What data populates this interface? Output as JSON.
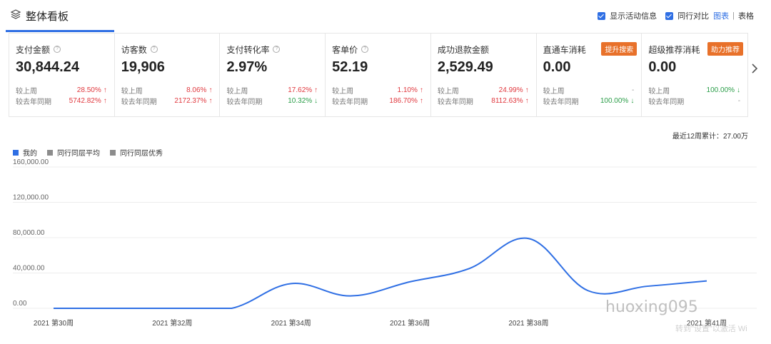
{
  "header": {
    "title": "整体看板",
    "show_activity_label": "显示活动信息",
    "peer_compare_label": "同行对比",
    "view_chart": "图表",
    "view_separator": "|",
    "view_table": "表格"
  },
  "metrics": [
    {
      "name": "支付金额",
      "value": "30,844.24",
      "tag": "",
      "help": true,
      "rows": [
        {
          "label": "较上周",
          "pct": "28.50%",
          "dir": "up"
        },
        {
          "label": "较去年同期",
          "pct": "5742.82%",
          "dir": "up"
        }
      ]
    },
    {
      "name": "访客数",
      "value": "19,906",
      "tag": "",
      "help": true,
      "rows": [
        {
          "label": "较上周",
          "pct": "8.06%",
          "dir": "up"
        },
        {
          "label": "较去年同期",
          "pct": "2172.37%",
          "dir": "up"
        }
      ]
    },
    {
      "name": "支付转化率",
      "value": "2.97%",
      "tag": "",
      "help": true,
      "rows": [
        {
          "label": "较上周",
          "pct": "17.62%",
          "dir": "up"
        },
        {
          "label": "较去年同期",
          "pct": "10.32%",
          "dir": "down"
        }
      ]
    },
    {
      "name": "客单价",
      "value": "52.19",
      "tag": "",
      "help": true,
      "rows": [
        {
          "label": "较上周",
          "pct": "1.10%",
          "dir": "up"
        },
        {
          "label": "较去年同期",
          "pct": "186.70%",
          "dir": "up"
        }
      ]
    },
    {
      "name": "成功退款金额",
      "value": "2,529.49",
      "tag": "",
      "help": false,
      "rows": [
        {
          "label": "较上周",
          "pct": "24.99%",
          "dir": "up"
        },
        {
          "label": "较去年同期",
          "pct": "8112.63%",
          "dir": "up"
        }
      ]
    },
    {
      "name": "直通车消耗",
      "value": "0.00",
      "tag": "提升搜索",
      "help": false,
      "rows": [
        {
          "label": "较上周",
          "pct": "-",
          "dir": "none"
        },
        {
          "label": "较去年同期",
          "pct": "100.00%",
          "dir": "down"
        }
      ]
    },
    {
      "name": "超级推荐消耗",
      "value": "0.00",
      "tag": "助力推荐",
      "help": false,
      "rows": [
        {
          "label": "较上周",
          "pct": "100.00%",
          "dir": "down"
        },
        {
          "label": "较去年同期",
          "pct": "-",
          "dir": "none"
        }
      ]
    }
  ],
  "colors": {
    "accent": "#2f6fe4",
    "up": "#e0383e",
    "down": "#2a9d48",
    "tag": "#e8712a"
  },
  "icons": {
    "title": "layers-icon",
    "next": "chevron-right-icon"
  },
  "cumulative": "最近12周累计：27.00万",
  "legend": [
    {
      "name": "我的",
      "color": "#2f6fe4"
    },
    {
      "name": "同行同层平均",
      "color": "#8c8c8c"
    },
    {
      "name": "同行同层优秀",
      "color": "#8c8c8c"
    }
  ],
  "watermark": "huoxing095",
  "watermark_sub": "转到\"设置\"以激活 Wi",
  "chart_data": {
    "type": "line",
    "x": [
      "2021 第30周",
      "2021 第31周",
      "2021 第32周",
      "2021 第33周",
      "2021 第34周",
      "2021 第35周",
      "2021 第36周",
      "2021 第37周",
      "2021 第38周",
      "2021 第39周",
      "2021 第40周",
      "2021 第41周"
    ],
    "tick_labels": [
      "2021 第30周",
      "2021 第32周",
      "2021 第34周",
      "2021 第36周",
      "2021 第38周",
      "2021 第41周"
    ],
    "tick_index": [
      0,
      2,
      4,
      6,
      8,
      11
    ],
    "yticks": [
      "0.00",
      "40,000.00",
      "80,000.00",
      "120,000.00",
      "160,000.00"
    ],
    "ylim": [
      0,
      160000
    ],
    "series": [
      {
        "name": "我的",
        "values": [
          0,
          0,
          0,
          0,
          28000,
          14000,
          30000,
          45000,
          79000,
          20000,
          25000,
          31000
        ]
      }
    ],
    "grid": true,
    "legend": "top-left"
  }
}
